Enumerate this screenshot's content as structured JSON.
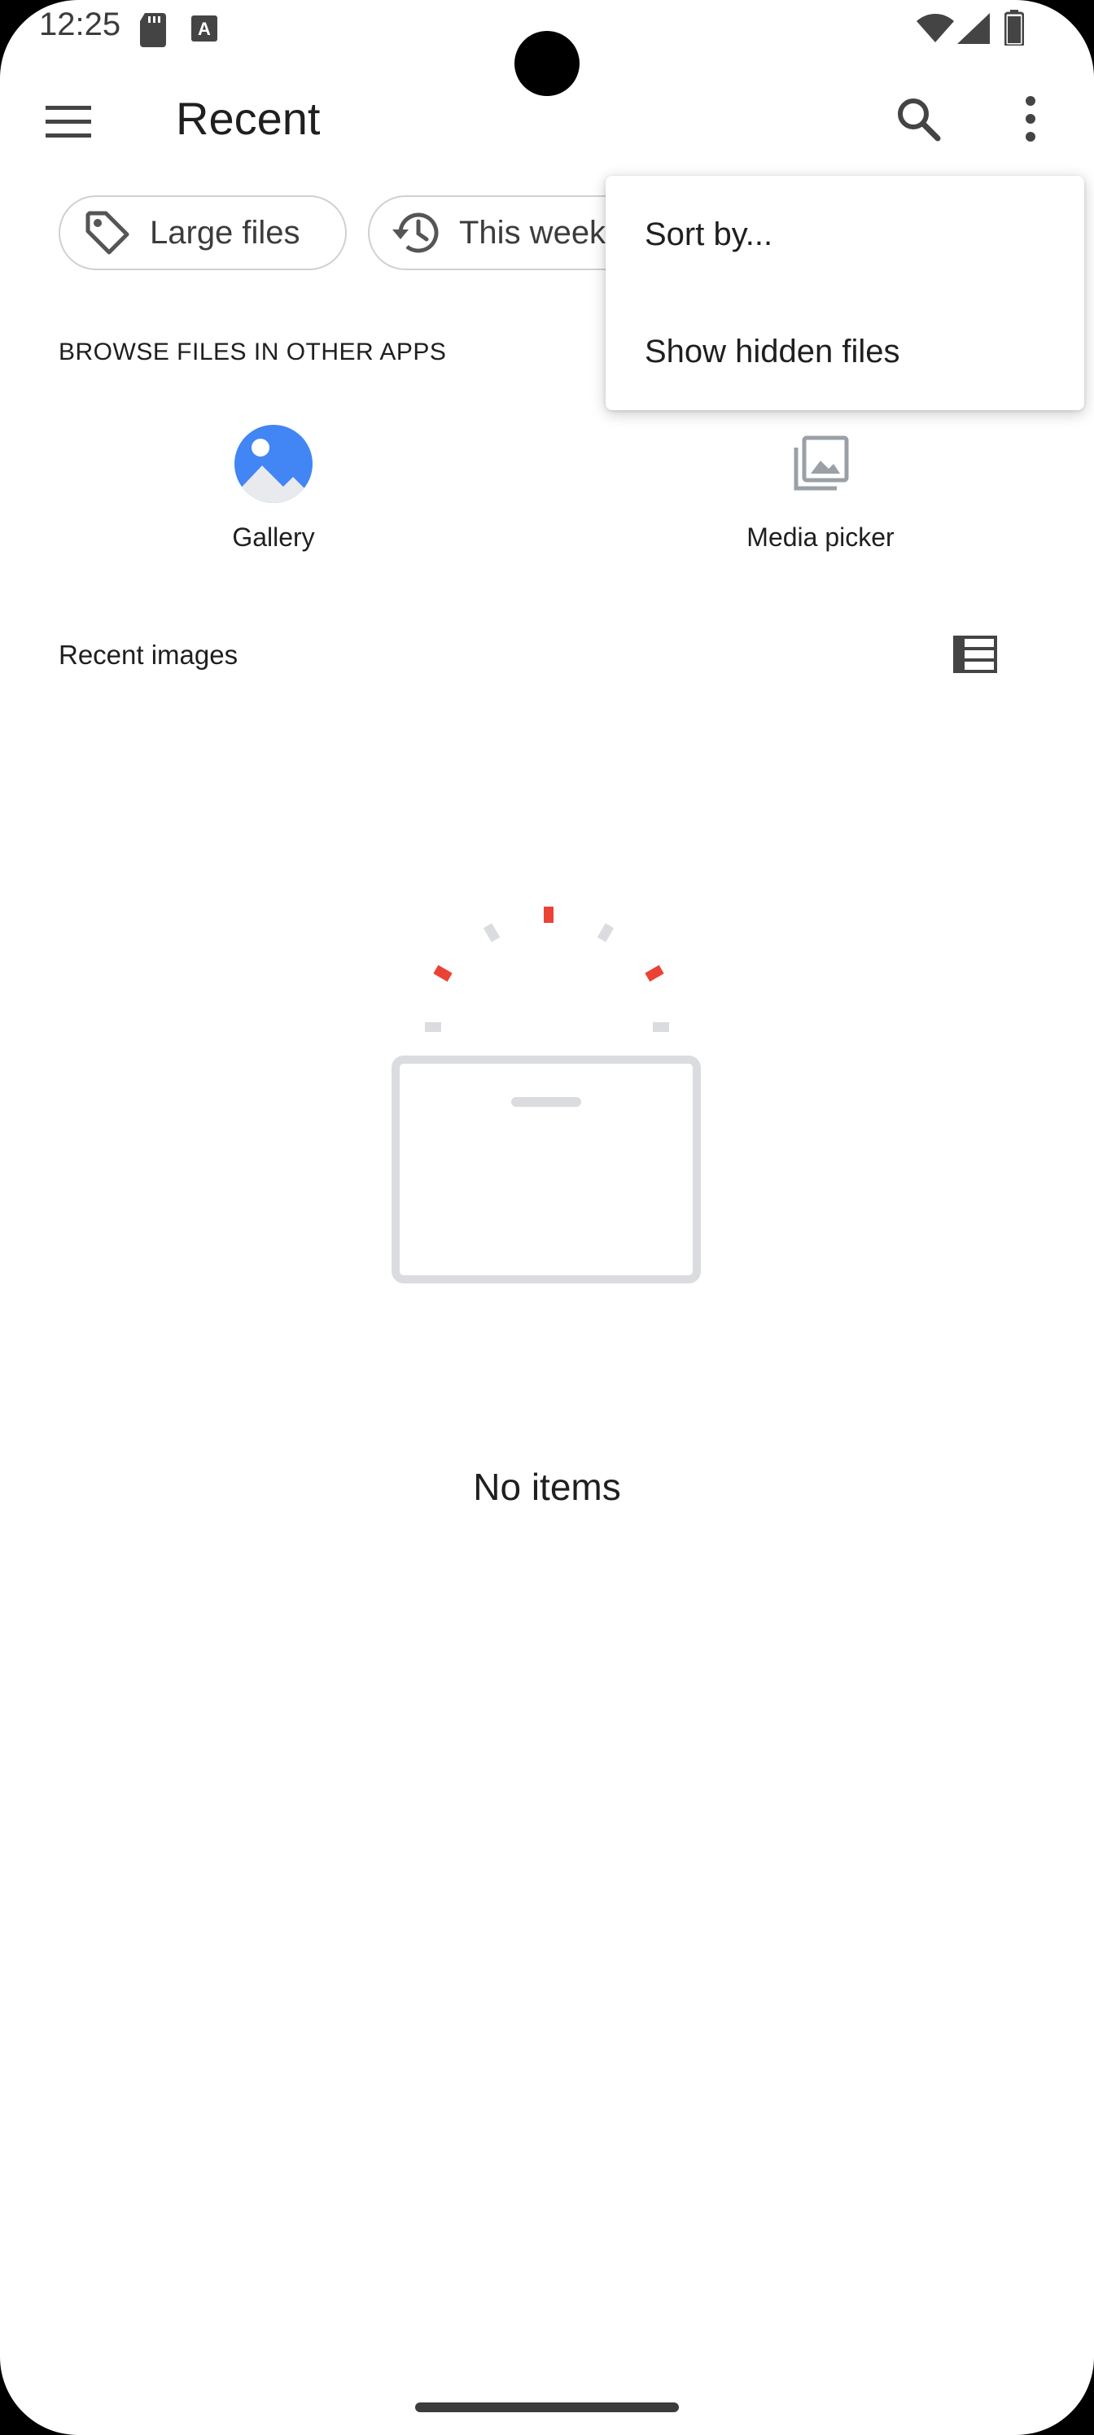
{
  "status_bar": {
    "time": "12:25",
    "icons": [
      "sd-card-icon",
      "keyboard-a-icon",
      "wifi-icon",
      "signal-icon",
      "battery-icon"
    ]
  },
  "app_bar": {
    "title": "Recent",
    "icons": [
      "menu-icon",
      "search-icon",
      "more-vert-icon"
    ]
  },
  "chips": [
    {
      "label": "Large files",
      "icon": "tag-icon"
    },
    {
      "label": "This week",
      "icon": "history-icon"
    }
  ],
  "browse_section": {
    "heading": "BROWSE FILES IN OTHER APPS",
    "apps": [
      {
        "label": "Gallery",
        "icon": "gallery-icon"
      },
      {
        "label": "Media picker",
        "icon": "media-picker-icon"
      }
    ]
  },
  "recent_images": {
    "heading": "Recent images",
    "view_toggle_icon": "list-view-icon"
  },
  "empty_state": {
    "text": "No items",
    "icon": "empty-box-icon"
  },
  "overflow_menu": {
    "items": [
      "Sort by...",
      "Show hidden files"
    ]
  },
  "colors": {
    "accent_blue": "#4285F4",
    "accent_red": "#EA4335",
    "chip_border": "#D0D0D0",
    "icon_gray": "#5F6368"
  }
}
